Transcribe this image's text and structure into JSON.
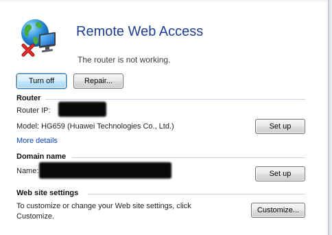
{
  "header": {
    "title": "Remote Web Access",
    "status": "The router is not working."
  },
  "actions": {
    "turn_off_label": "Turn off",
    "repair_label": "Repair..."
  },
  "router": {
    "section_title": "Router",
    "ip_label": "Router IP:",
    "model_text": "Model: HG659 (Huawei Technologies Co., Ltd.)",
    "setup_label": "Set up",
    "more_details_label": "More details"
  },
  "domain": {
    "section_title": "Domain name",
    "name_label": "Name:",
    "setup_label": "Set up"
  },
  "website": {
    "section_title": "Web site settings",
    "description_line1": "To customize or change your Web site settings, click",
    "description_line2": "Customize.",
    "customize_label": "Customize..."
  },
  "icons": {
    "app_icon": "globe-computer-icon",
    "error_badge": "red-x-error-icon"
  },
  "colors": {
    "title": "#1e3e92",
    "link": "#0a46b4",
    "error": "#d42020"
  }
}
